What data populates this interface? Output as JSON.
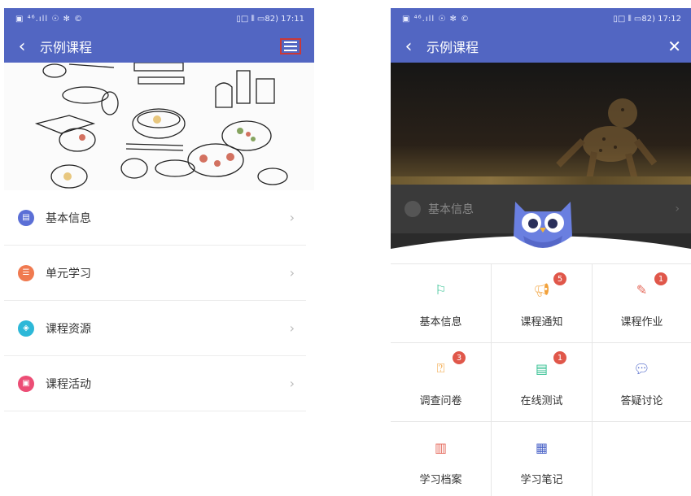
{
  "left": {
    "status": {
      "left": "▣ ⁴⁶.ıll ☉ ✻ ©",
      "right": "▯□ ⫴ ▭82) 17:11"
    },
    "title": "示例课程",
    "list": [
      {
        "label": "基本信息",
        "icon": "info-icon",
        "color": "#5b6fd6"
      },
      {
        "label": "单元学习",
        "icon": "list-icon",
        "color": "#f07a50"
      },
      {
        "label": "课程资源",
        "icon": "stack-icon",
        "color": "#2db8d8"
      },
      {
        "label": "课程活动",
        "icon": "activity-icon",
        "color": "#ec4d75"
      }
    ]
  },
  "right": {
    "status": {
      "left": "▣ ⁴⁶.ıll ☉ ✻ ©",
      "right": "▯□ ⫴ ▭82) 17:12"
    },
    "title": "示例课程",
    "dim_row_label": "基本信息",
    "grid": [
      {
        "label": "基本信息",
        "icon": "flag-icon",
        "color": "#2fbf8f",
        "badge": ""
      },
      {
        "label": "课程通知",
        "icon": "megaphone-icon",
        "color": "#f2a13a",
        "badge": "5"
      },
      {
        "label": "课程作业",
        "icon": "edit-icon",
        "color": "#e56a5c",
        "badge": "1"
      },
      {
        "label": "调查问卷",
        "icon": "question-doc-icon",
        "color": "#f2a13a",
        "badge": "3"
      },
      {
        "label": "在线测试",
        "icon": "clipboard-icon",
        "color": "#2fbf8f",
        "badge": "1"
      },
      {
        "label": "答疑讨论",
        "icon": "chat-icon",
        "color": "#4a63c8",
        "badge": ""
      },
      {
        "label": "学习档案",
        "icon": "bar-chart-icon",
        "color": "#e56a5c",
        "badge": ""
      },
      {
        "label": "学习笔记",
        "icon": "calendar-icon",
        "color": "#4a63c8",
        "badge": ""
      }
    ]
  }
}
